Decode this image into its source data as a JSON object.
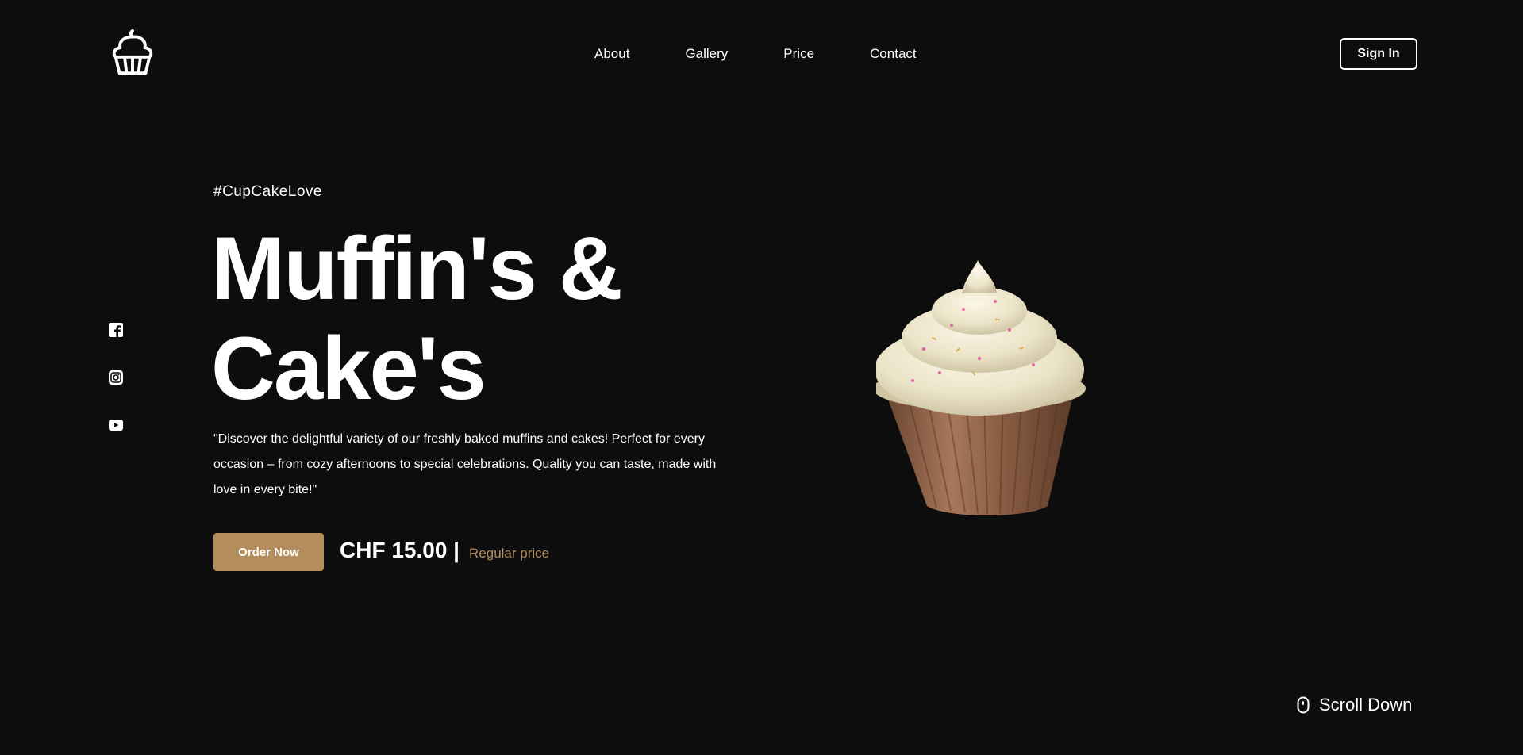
{
  "header": {
    "logo_icon": "cupcake-logo-icon",
    "nav": [
      {
        "label": "About"
      },
      {
        "label": "Gallery"
      },
      {
        "label": "Price"
      },
      {
        "label": "Contact"
      }
    ],
    "signin_label": "Sign In"
  },
  "social": [
    {
      "icon": "facebook-icon"
    },
    {
      "icon": "instagram-icon"
    },
    {
      "icon": "youtube-icon"
    }
  ],
  "hero": {
    "hashtag": "#CupCakeLove",
    "title_line1": "Muffin's &",
    "title_line2": "Cake's",
    "description": "\"Discover the delightful variety of our freshly baked muffins and cakes! Perfect for every occasion – from cozy afternoons to special celebrations. Quality you can taste, made with love in every bite!\"",
    "order_label": "Order Now",
    "price": "CHF 15.00 |",
    "price_note": "Regular price",
    "image_icon": "cupcake-illustration"
  },
  "scroll": {
    "label": "Scroll Down",
    "icon": "mouse-icon"
  },
  "colors": {
    "background": "#0d0d0d",
    "accent": "#b48d5d",
    "text": "#ffffff"
  }
}
